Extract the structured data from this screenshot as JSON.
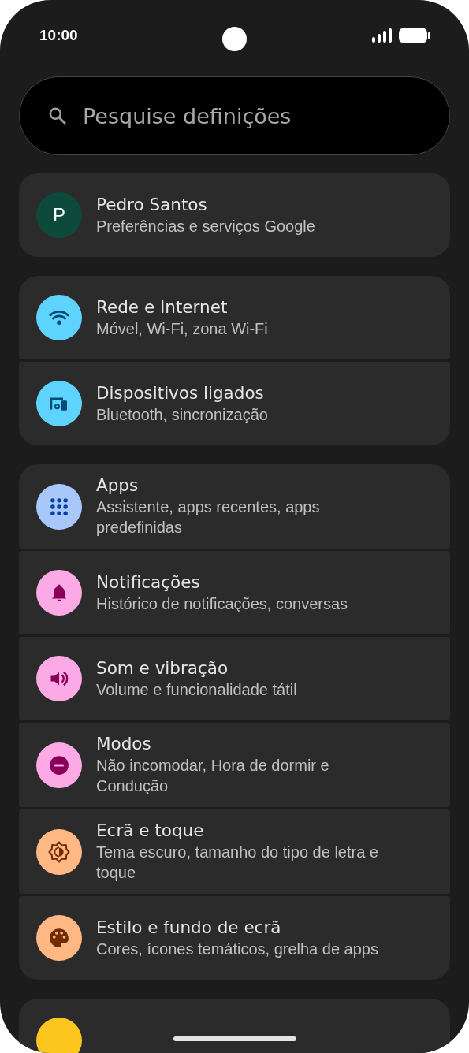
{
  "status_bar": {
    "time": "10:00"
  },
  "search": {
    "placeholder": "Pesquise definições"
  },
  "groups": [
    {
      "items": [
        {
          "kind": "account",
          "avatar": "P",
          "color": "#0d4a3b",
          "title": "Pedro Santos",
          "subtitle": "Preferências e serviços Google"
        }
      ]
    },
    {
      "items": [
        {
          "kind": "setting",
          "color": "#5dd3fe",
          "title": "Rede e Internet",
          "subtitle": "Móvel, Wi-Fi, zona Wi-Fi"
        },
        {
          "kind": "setting",
          "color": "#5dd3fe",
          "title": "Dispositivos ligados",
          "subtitle": "Bluetooth, sincronização"
        }
      ]
    },
    {
      "items": [
        {
          "kind": "setting",
          "color": "#a8c7fa",
          "title": "Apps",
          "subtitle": "Assistente, apps recentes, apps predefinidas"
        },
        {
          "kind": "setting",
          "color": "#fcaae6",
          "title": "Notificações",
          "subtitle": "Histórico de notificações, conversas"
        },
        {
          "kind": "setting",
          "color": "#fcaae6",
          "title": "Som e vibração",
          "subtitle": "Volume e funcionalidade tátil"
        },
        {
          "kind": "setting",
          "color": "#fcaae6",
          "title": "Modos",
          "subtitle": "Não incomodar, Hora de dormir e Condução"
        },
        {
          "kind": "setting",
          "color": "#ffb784",
          "title": "Ecrã e toque",
          "subtitle": "Tema escuro, tamanho do tipo de letra e toque"
        },
        {
          "kind": "setting",
          "color": "#ffb784",
          "title": "Estilo e fundo de ecrã",
          "subtitle": "Cores, ícones temáticos, grelha de apps"
        }
      ]
    },
    {
      "items": [
        {
          "kind": "setting",
          "color": "#fcc61f"
        }
      ]
    }
  ]
}
